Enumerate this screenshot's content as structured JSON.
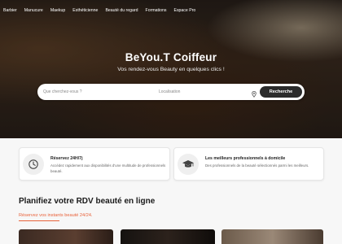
{
  "nav": {
    "items": [
      "Barbier",
      "Manucure",
      "Maekup",
      "Esthéticienne",
      "Beauté du regard",
      "Formations",
      "Espace Pro"
    ]
  },
  "hero": {
    "title": "BeYou.T Coiffeur",
    "subtitle": "Vos rendez-vous Beauty en quelques clics !"
  },
  "search": {
    "query_placeholder": "Que cherchez-vous ?",
    "location_placeholder": "Localisation",
    "button_label": "Recherche"
  },
  "cards": [
    {
      "icon": "clock-icon",
      "title": "Réservez 24H/7j",
      "text": "Accédez rapidement aux disponibilités d'une multitude de professionnels beauté."
    },
    {
      "icon": "graduation-cap-icon",
      "title": "Les meilleurs professionnels à domicile",
      "text": "Des professionnels de la beauté sélectionnés parmi les meilleurs."
    }
  ],
  "section": {
    "title": "Planifiez votre RDV beauté en ligne",
    "subtitle": "Réservez vos instants beauté 24/24."
  },
  "colors": {
    "accent": "#e8623a",
    "button_dark": "#2b2b2b"
  }
}
